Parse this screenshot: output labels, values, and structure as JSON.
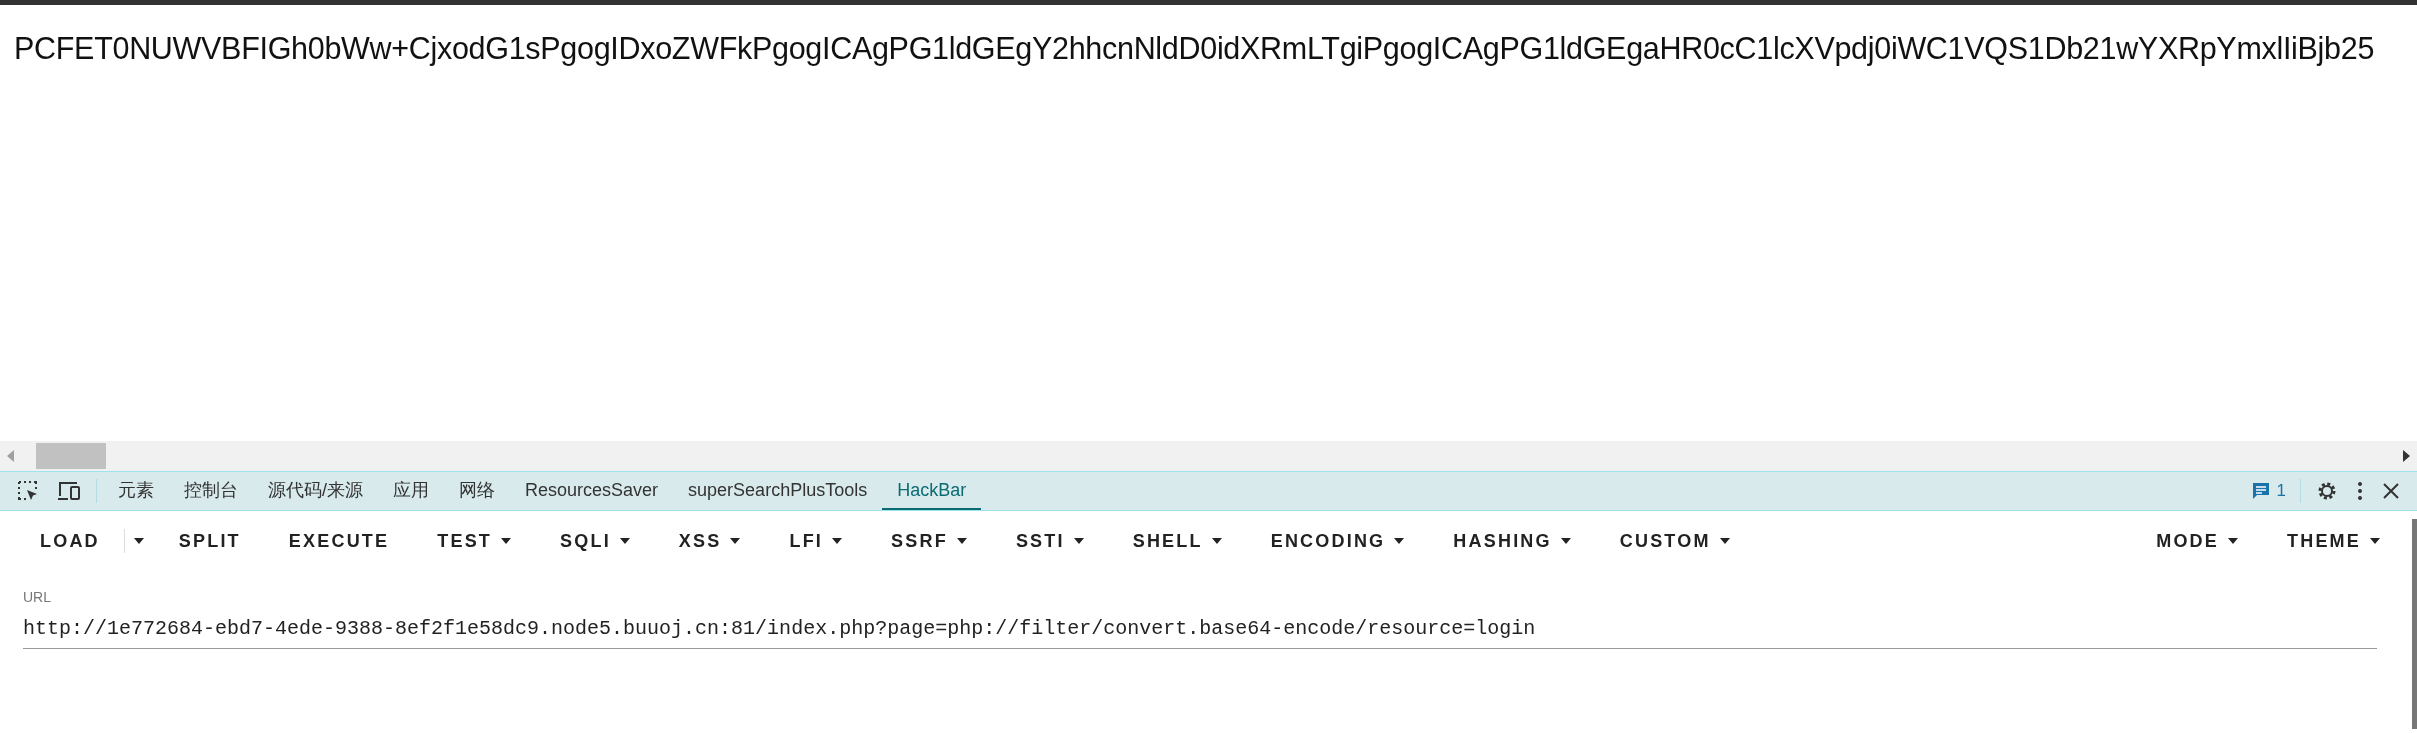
{
  "page_text": "PCFET0NUWVBFIGh0bWw+CjxodG1sPgogIDxoZWFkPgogICAgPG1ldGEgY2hhcnNldD0idXRmLTgiPgogICAgPG1ldGEgaHR0cC1lcXVpdj0iWC1VQS1Db21wYXRpYmxlIiBjb25",
  "devtools": {
    "tabs": [
      {
        "label": "元素",
        "selected": false
      },
      {
        "label": "控制台",
        "selected": false
      },
      {
        "label": "源代码/来源",
        "selected": false
      },
      {
        "label": "应用",
        "selected": false
      },
      {
        "label": "网络",
        "selected": false
      },
      {
        "label": "ResourcesSaver",
        "selected": false
      },
      {
        "label": "superSearchPlusTools",
        "selected": false
      },
      {
        "label": "HackBar",
        "selected": true
      }
    ],
    "issues_count": "1"
  },
  "hackbar": {
    "buttons": [
      {
        "label": "LOAD",
        "kind": "split"
      },
      {
        "label": "SPLIT",
        "kind": "plain"
      },
      {
        "label": "EXECUTE",
        "kind": "plain"
      },
      {
        "label": "TEST",
        "kind": "menu"
      },
      {
        "label": "SQLI",
        "kind": "menu"
      },
      {
        "label": "XSS",
        "kind": "menu"
      },
      {
        "label": "LFI",
        "kind": "menu"
      },
      {
        "label": "SSRF",
        "kind": "menu"
      },
      {
        "label": "SSTI",
        "kind": "menu"
      },
      {
        "label": "SHELL",
        "kind": "menu"
      },
      {
        "label": "ENCODING",
        "kind": "menu"
      },
      {
        "label": "HASHING",
        "kind": "menu"
      },
      {
        "label": "CUSTOM",
        "kind": "menu"
      }
    ],
    "right_buttons": [
      {
        "label": "MODE",
        "kind": "menu"
      },
      {
        "label": "THEME",
        "kind": "menu"
      }
    ],
    "url": {
      "label": "URL",
      "value": "http://1e772684-ebd7-4ede-9388-8ef2f1e58dc9.node5.buuoj.cn:81/index.php?page=php://filter/convert.base64-encode/resource=login"
    }
  }
}
